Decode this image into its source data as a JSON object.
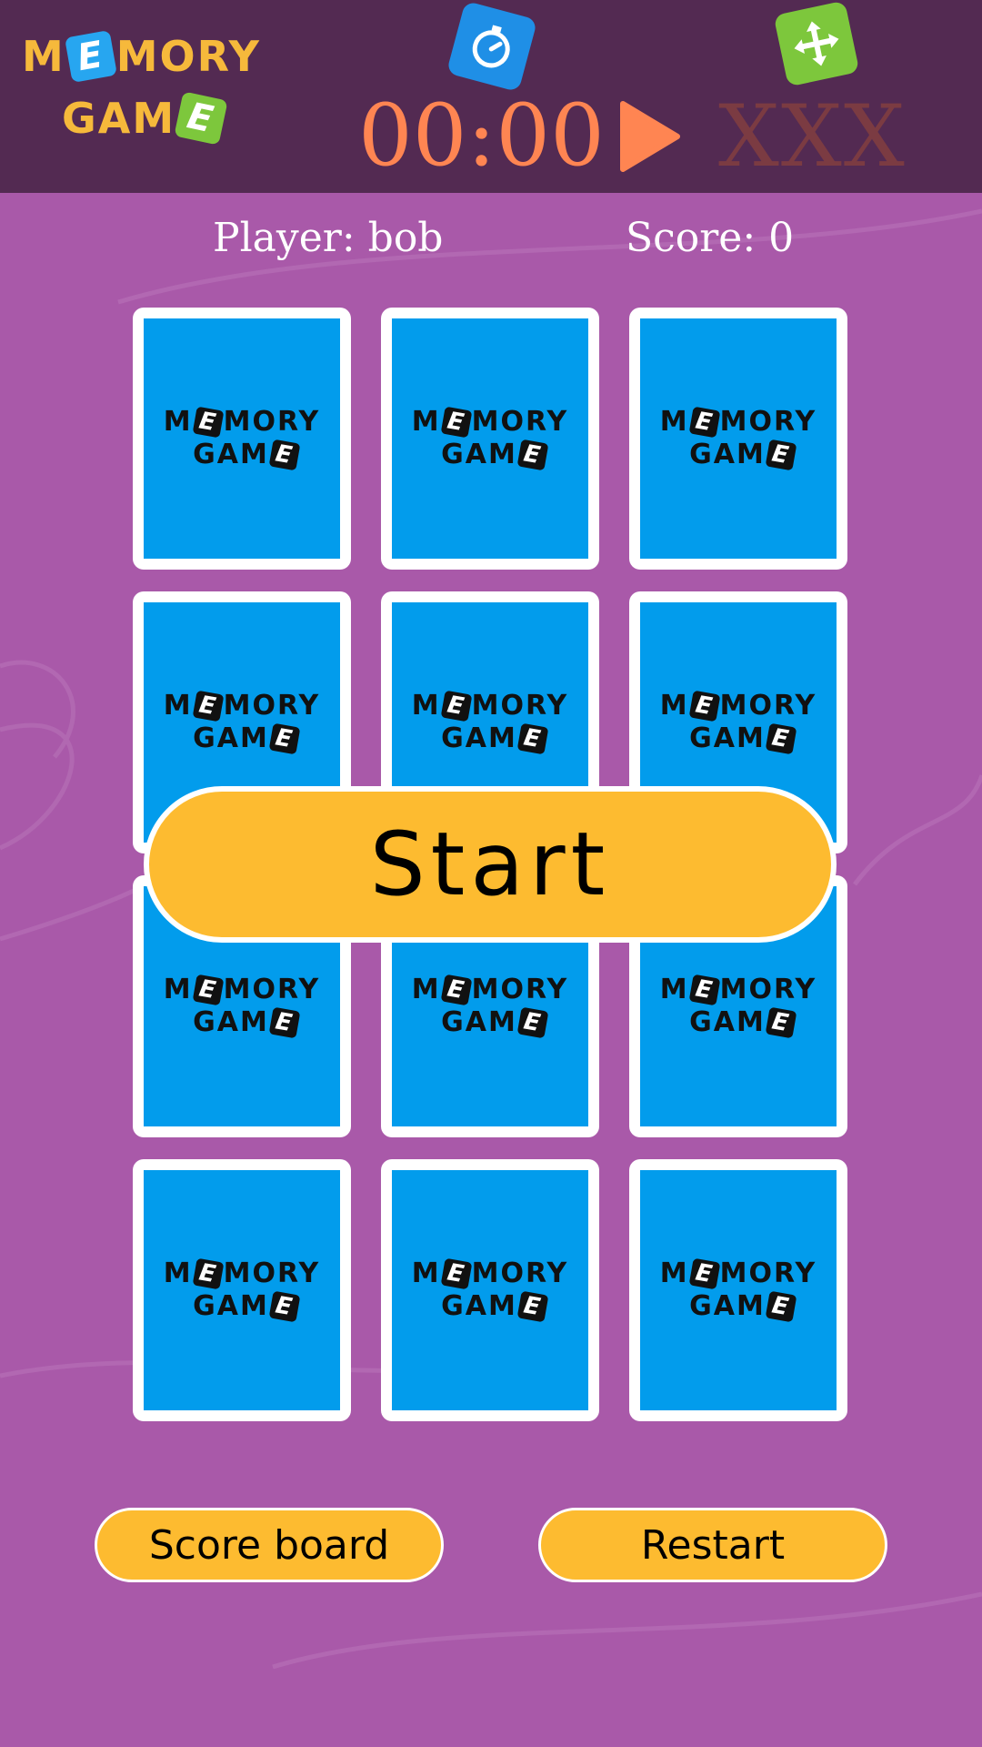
{
  "header": {
    "logo": {
      "line1": [
        "M",
        "E",
        "MORY"
      ],
      "line2": [
        "GAM",
        "E"
      ]
    },
    "timer": "00:00",
    "lives": "XXX",
    "icons": {
      "timer": "stopwatch-icon",
      "move": "move-arrows-icon",
      "play": "play-icon"
    }
  },
  "status": {
    "player": "Player: bob",
    "score": "Score: 0"
  },
  "card_back": {
    "line1": [
      "M",
      "E",
      "MORY"
    ],
    "line2": [
      "GAM",
      "E"
    ]
  },
  "grid": {
    "rows": 4,
    "cols": 3,
    "card_count": 12
  },
  "buttons": {
    "start": "Start",
    "scoreboard": "Score board",
    "restart": "Restart"
  },
  "colors": {
    "header_bg": "#532a52",
    "page_bg": "#a959a9",
    "card_face": "#029cec",
    "button": "#fdbb30",
    "timer": "#ff8552",
    "lives": "#7b3b42"
  }
}
